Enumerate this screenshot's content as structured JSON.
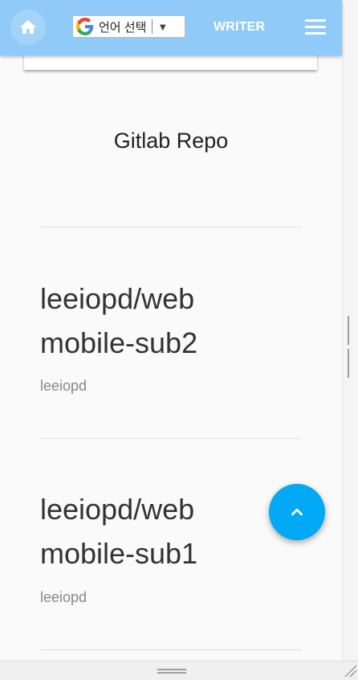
{
  "header": {
    "lang_label": "언어 선택",
    "writer_label": "WRITER",
    "brand_color": "#90caf9",
    "icons": {
      "home": "home-icon",
      "menu": "hamburger-menu-icon",
      "google": "google-g-icon"
    }
  },
  "main": {
    "section_title": "Gitlab Repo",
    "repos": [
      {
        "title": "leeiopd/web mobile-sub2",
        "owner": "leeiopd"
      },
      {
        "title": "leeiopd/web mobile-sub1",
        "owner": "leeiopd"
      }
    ]
  },
  "fab": {
    "icon": "chevron-up-icon",
    "color": "#03a9f4"
  }
}
